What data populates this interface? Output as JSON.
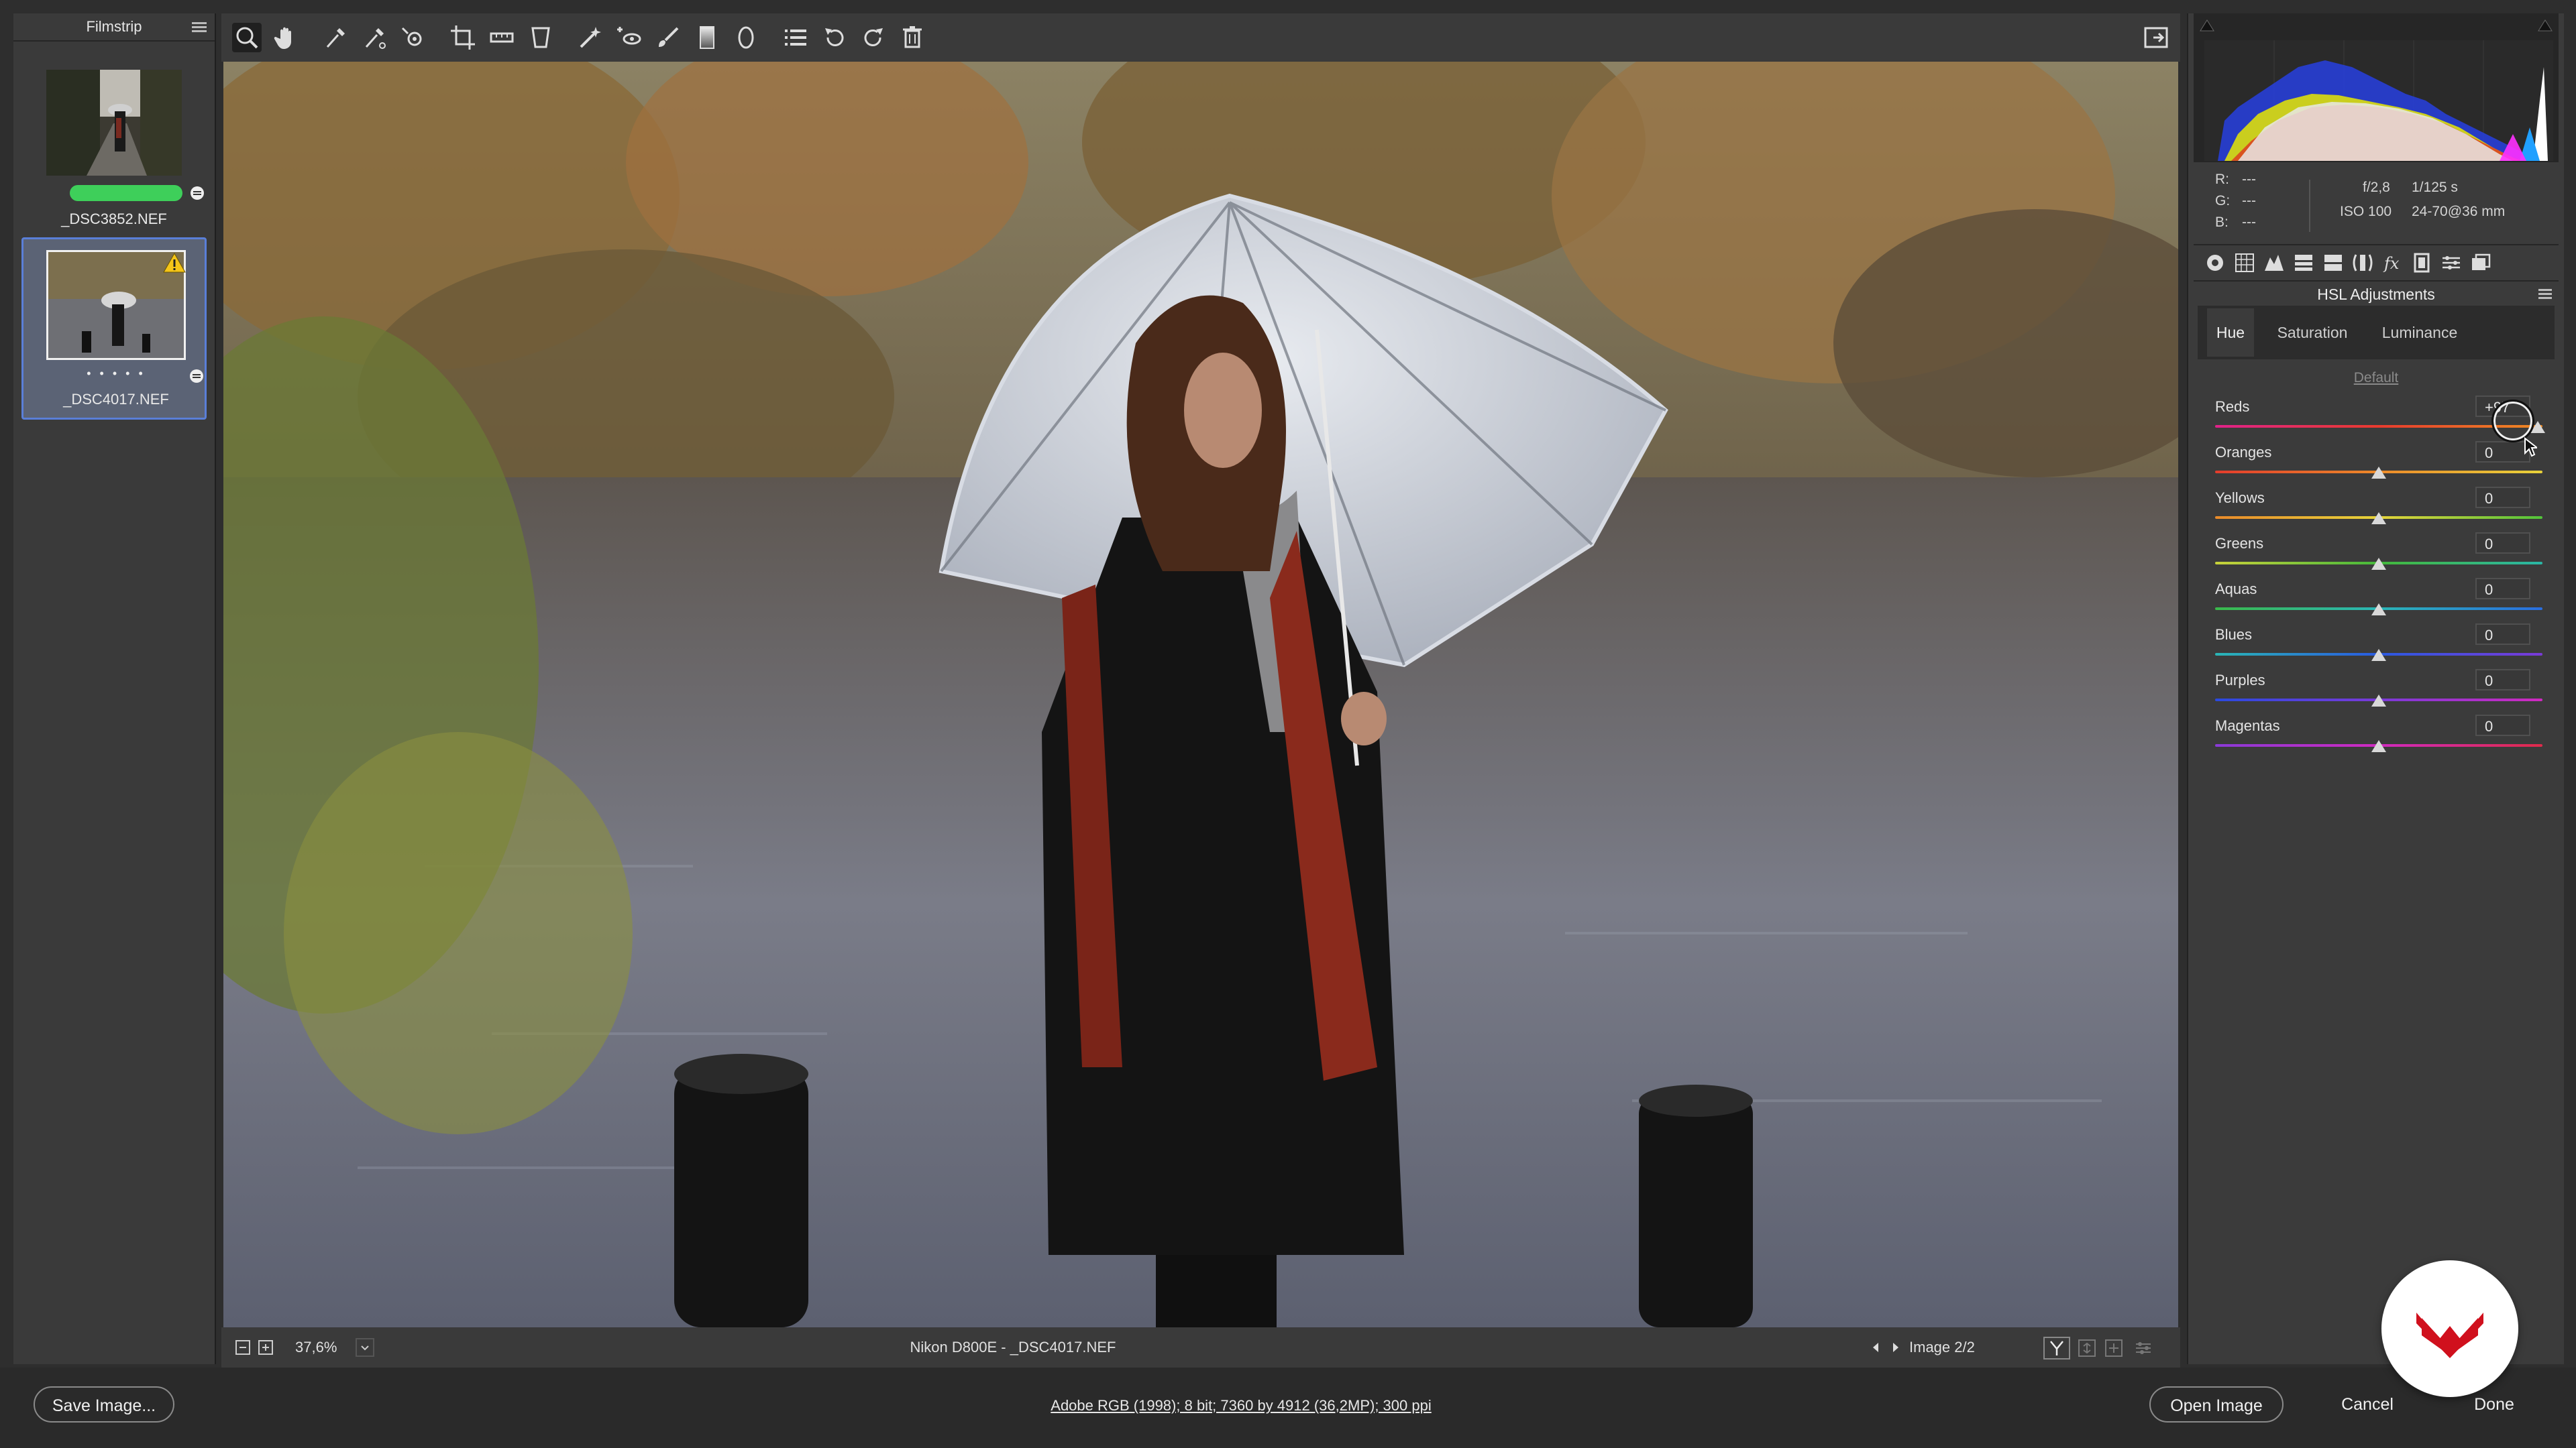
{
  "filmstrip": {
    "title": "Filmstrip",
    "items": [
      {
        "name": "_DSC3852.NEF"
      },
      {
        "name": "_DSC4017.NEF",
        "rating_dots": "• • • • •"
      }
    ]
  },
  "toolbar": {
    "tools": [
      "zoom-icon",
      "hand-icon",
      "white-balance-icon",
      "color-sampler-icon",
      "targeted-adjustment-icon",
      "crop-icon",
      "straighten-icon",
      "transform-icon",
      "spot-removal-icon",
      "red-eye-icon",
      "adjustment-brush-icon",
      "graduated-filter-icon",
      "radial-filter-icon",
      "presets-icon",
      "rotate-left-icon",
      "rotate-right-icon",
      "trash-icon"
    ]
  },
  "status": {
    "zoom": "37,6%",
    "filename": "Nikon D800E  -  _DSC4017.NEF",
    "image_counter": "Image 2/2"
  },
  "info": {
    "r_label": "R:",
    "r_value": "---",
    "g_label": "G:",
    "g_value": "---",
    "b_label": "B:",
    "b_value": "---",
    "aperture": "f/2,8",
    "shutter": "1/125 s",
    "iso": "ISO 100",
    "lens": "24-70@36 mm"
  },
  "panel": {
    "title": "HSL Adjustments",
    "tabs": [
      "Hue",
      "Saturation",
      "Luminance"
    ],
    "active_tab": "Hue",
    "default_label": "Default",
    "sliders": [
      {
        "label": "Reds",
        "value": "+97",
        "fraction": 0.985
      },
      {
        "label": "Oranges",
        "value": "0",
        "fraction": 0.5
      },
      {
        "label": "Yellows",
        "value": "0",
        "fraction": 0.5
      },
      {
        "label": "Greens",
        "value": "0",
        "fraction": 0.5
      },
      {
        "label": "Aquas",
        "value": "0",
        "fraction": 0.5
      },
      {
        "label": "Blues",
        "value": "0",
        "fraction": 0.5
      },
      {
        "label": "Purples",
        "value": "0",
        "fraction": 0.5
      },
      {
        "label": "Magentas",
        "value": "0",
        "fraction": 0.5
      }
    ]
  },
  "footer": {
    "save_label": "Save Image...",
    "workflow_link": "Adobe RGB (1998); 8 bit; 7360 by 4912 (36,2MP); 300 ppi",
    "open_label": "Open Image",
    "cancel_label": "Cancel",
    "done_label": "Done"
  },
  "colors": {
    "selection_accent": "#5a7fd8",
    "rating_bar": "#3ecf5a",
    "warning": "#f5c518",
    "brand_logo": "#d0101d"
  }
}
